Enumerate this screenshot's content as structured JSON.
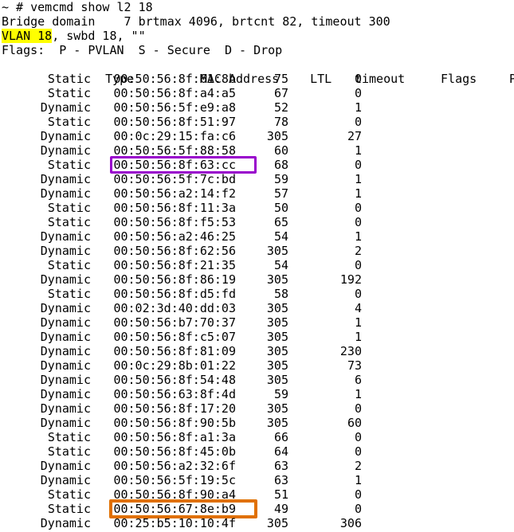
{
  "terminal": {
    "prompt_line": "~ # vemcmd show l2 18",
    "bridge_domain_line": "Bridge domain    7 brtmax 4096, brtcnt 82, timeout 300",
    "vlan_line": {
      "highlight": "VLAN 18",
      "rest": ", swbd 18, \"\""
    },
    "flags_line": "Flags:  P - PVLAN  S - Secure  D - Drop",
    "columns": [
      "Type",
      "MAC Address",
      "LTL",
      "timeout",
      "Flags",
      "PVLAN"
    ],
    "rows": [
      {
        "type": "Static",
        "mac": "00:50:56:8f:61:8b",
        "ltl": "75",
        "timeout": "0",
        "flags": "",
        "pvlan": ""
      },
      {
        "type": "Static",
        "mac": "00:50:56:8f:a4:a5",
        "ltl": "67",
        "timeout": "0",
        "flags": "",
        "pvlan": ""
      },
      {
        "type": "Dynamic",
        "mac": "00:50:56:5f:e9:a8",
        "ltl": "52",
        "timeout": "1",
        "flags": "",
        "pvlan": ""
      },
      {
        "type": "Static",
        "mac": "00:50:56:8f:51:97",
        "ltl": "78",
        "timeout": "0",
        "flags": "",
        "pvlan": ""
      },
      {
        "type": "Dynamic",
        "mac": "00:0c:29:15:fa:c6",
        "ltl": "305",
        "timeout": "27",
        "flags": "",
        "pvlan": ""
      },
      {
        "type": "Dynamic",
        "mac": "00:50:56:5f:88:58",
        "ltl": "60",
        "timeout": "1",
        "flags": "",
        "pvlan": ""
      },
      {
        "type": "Static",
        "mac": "00:50:56:8f:63:cc",
        "ltl": "68",
        "timeout": "0",
        "flags": "",
        "pvlan": "",
        "highlight": "purple"
      },
      {
        "type": "Dynamic",
        "mac": "00:50:56:5f:7c:bd",
        "ltl": "59",
        "timeout": "1",
        "flags": "",
        "pvlan": ""
      },
      {
        "type": "Dynamic",
        "mac": "00:50:56:a2:14:f2",
        "ltl": "57",
        "timeout": "1",
        "flags": "",
        "pvlan": ""
      },
      {
        "type": "Static",
        "mac": "00:50:56:8f:11:3a",
        "ltl": "50",
        "timeout": "0",
        "flags": "",
        "pvlan": ""
      },
      {
        "type": "Static",
        "mac": "00:50:56:8f:f5:53",
        "ltl": "65",
        "timeout": "0",
        "flags": "",
        "pvlan": ""
      },
      {
        "type": "Dynamic",
        "mac": "00:50:56:a2:46:25",
        "ltl": "54",
        "timeout": "1",
        "flags": "",
        "pvlan": ""
      },
      {
        "type": "Dynamic",
        "mac": "00:50:56:8f:62:56",
        "ltl": "305",
        "timeout": "2",
        "flags": "",
        "pvlan": ""
      },
      {
        "type": "Static",
        "mac": "00:50:56:8f:21:35",
        "ltl": "54",
        "timeout": "0",
        "flags": "",
        "pvlan": ""
      },
      {
        "type": "Dynamic",
        "mac": "00:50:56:8f:86:19",
        "ltl": "305",
        "timeout": "192",
        "flags": "",
        "pvlan": ""
      },
      {
        "type": "Static",
        "mac": "00:50:56:8f:d5:fd",
        "ltl": "58",
        "timeout": "0",
        "flags": "",
        "pvlan": ""
      },
      {
        "type": "Dynamic",
        "mac": "00:02:3d:40:dd:03",
        "ltl": "305",
        "timeout": "4",
        "flags": "",
        "pvlan": ""
      },
      {
        "type": "Dynamic",
        "mac": "00:50:56:b7:70:37",
        "ltl": "305",
        "timeout": "1",
        "flags": "",
        "pvlan": ""
      },
      {
        "type": "Dynamic",
        "mac": "00:50:56:8f:c5:07",
        "ltl": "305",
        "timeout": "1",
        "flags": "",
        "pvlan": ""
      },
      {
        "type": "Dynamic",
        "mac": "00:50:56:8f:81:09",
        "ltl": "305",
        "timeout": "230",
        "flags": "",
        "pvlan": ""
      },
      {
        "type": "Dynamic",
        "mac": "00:0c:29:8b:01:22",
        "ltl": "305",
        "timeout": "73",
        "flags": "",
        "pvlan": ""
      },
      {
        "type": "Dynamic",
        "mac": "00:50:56:8f:54:48",
        "ltl": "305",
        "timeout": "6",
        "flags": "",
        "pvlan": ""
      },
      {
        "type": "Dynamic",
        "mac": "00:50:56:63:8f:4d",
        "ltl": "59",
        "timeout": "1",
        "flags": "",
        "pvlan": ""
      },
      {
        "type": "Dynamic",
        "mac": "00:50:56:8f:17:20",
        "ltl": "305",
        "timeout": "0",
        "flags": "",
        "pvlan": ""
      },
      {
        "type": "Dynamic",
        "mac": "00:50:56:8f:90:5b",
        "ltl": "305",
        "timeout": "60",
        "flags": "",
        "pvlan": ""
      },
      {
        "type": "Static",
        "mac": "00:50:56:8f:a1:3a",
        "ltl": "66",
        "timeout": "0",
        "flags": "",
        "pvlan": ""
      },
      {
        "type": "Static",
        "mac": "00:50:56:8f:45:0b",
        "ltl": "64",
        "timeout": "0",
        "flags": "",
        "pvlan": ""
      },
      {
        "type": "Dynamic",
        "mac": "00:50:56:a2:32:6f",
        "ltl": "63",
        "timeout": "2",
        "flags": "",
        "pvlan": ""
      },
      {
        "type": "Dynamic",
        "mac": "00:50:56:5f:19:5c",
        "ltl": "63",
        "timeout": "1",
        "flags": "",
        "pvlan": ""
      },
      {
        "type": "Static",
        "mac": "00:50:56:8f:90:a4",
        "ltl": "51",
        "timeout": "0",
        "flags": "",
        "pvlan": ""
      },
      {
        "type": "Static",
        "mac": "00:50:56:67:8e:b9",
        "ltl": "49",
        "timeout": "0",
        "flags": "",
        "pvlan": "",
        "highlight": "orange"
      },
      {
        "type": "Dynamic",
        "mac": "00:25:b5:10:10:4f",
        "ltl": "305",
        "timeout": "306",
        "flags": "",
        "pvlan": ""
      }
    ]
  },
  "colors": {
    "background": "#ffffff",
    "text": "#000000",
    "highlight_yellow": "#ffff00",
    "annotation_purple": "#9900cc",
    "annotation_orange": "#e07000"
  }
}
